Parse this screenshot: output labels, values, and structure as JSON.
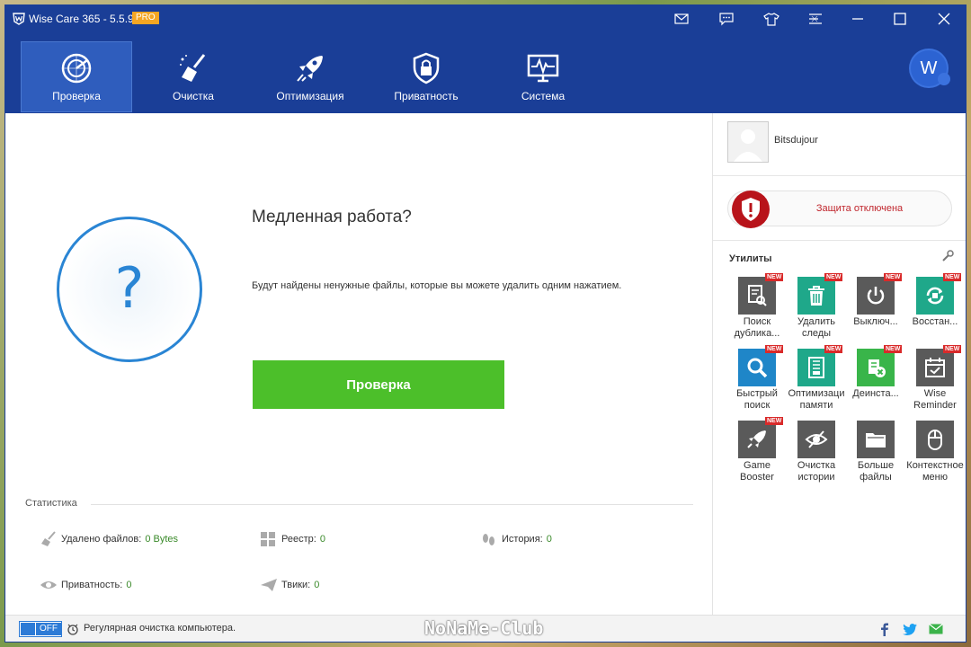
{
  "titlebar": {
    "title": "Wise Care 365 - 5.5.9",
    "badge": "PRO"
  },
  "nav": {
    "tabs": [
      {
        "label": "Проверка",
        "icon": "radar-icon",
        "active": true
      },
      {
        "label": "Очистка",
        "icon": "broom-icon",
        "active": false
      },
      {
        "label": "Оптимизация",
        "icon": "rocket-icon",
        "active": false
      },
      {
        "label": "Приватность",
        "icon": "lock-shield-icon",
        "active": false
      },
      {
        "label": "Система",
        "icon": "monitor-pulse-icon",
        "active": false
      }
    ],
    "account_initial": "W"
  },
  "main": {
    "heading": "Медленная работа?",
    "description": "Будут найдены ненужные файлы, которые вы можете удалить одним нажатием.",
    "scan_button": "Проверка",
    "question_mark": "?"
  },
  "stats": {
    "title": "Статистика",
    "items": [
      {
        "label": "Удалено файлов:",
        "value": "0 Bytes",
        "icon": "broom-icon"
      },
      {
        "label": "Реестр:",
        "value": "0",
        "icon": "registry-blocks-icon"
      },
      {
        "label": "История:",
        "value": "0",
        "icon": "footprints-icon"
      },
      {
        "label": "Приватность:",
        "value": "0",
        "icon": "eye-icon"
      },
      {
        "label": "Твики:",
        "value": "0",
        "icon": "paper-plane-icon"
      }
    ]
  },
  "side": {
    "user_name": "Bitsdujour",
    "protection_status": "Защита отключена",
    "utilities_title": "Утилиты",
    "new_label": "NEW",
    "tools": [
      {
        "line1": "Поиск",
        "line2": "дублика...",
        "color": "#5a5a5a",
        "icon": "duplicate-search-icon",
        "new": true
      },
      {
        "line1": "Удалить",
        "line2": "следы",
        "color": "#1fa88a",
        "icon": "trash-icon",
        "new": true
      },
      {
        "line1": "Выключ...",
        "line2": "",
        "color": "#5a5a5a",
        "icon": "power-icon",
        "new": true
      },
      {
        "line1": "Восстан...",
        "line2": "",
        "color": "#1fa88a",
        "icon": "restore-icon",
        "new": true
      },
      {
        "line1": "Быстрый",
        "line2": "поиск",
        "color": "#1f86c8",
        "icon": "magnifier-icon",
        "new": true
      },
      {
        "line1": "Оптимизаци",
        "line2": "памяти",
        "color": "#1fa88a",
        "icon": "memory-icon",
        "new": true
      },
      {
        "line1": "Деинста...",
        "line2": "",
        "color": "#39b54a",
        "icon": "uninstall-icon",
        "new": true
      },
      {
        "line1": "Wise",
        "line2": "Reminder",
        "color": "#5a5a5a",
        "icon": "calendar-check-icon",
        "new": true
      },
      {
        "line1": "Game",
        "line2": "Booster",
        "color": "#5a5a5a",
        "icon": "game-rocket-icon",
        "new": true
      },
      {
        "line1": "Очистка",
        "line2": "истории",
        "color": "#5a5a5a",
        "icon": "eye-slash-icon",
        "new": false
      },
      {
        "line1": "Больше",
        "line2": "файлы",
        "color": "#5a5a5a",
        "icon": "folder-icon",
        "new": false
      },
      {
        "line1": "Контекстное",
        "line2": "меню",
        "color": "#5a5a5a",
        "icon": "mouse-icon",
        "new": false
      }
    ]
  },
  "footer": {
    "toggle_label": "OFF",
    "text": "Регулярная очистка компьютера.",
    "watermark": "NoNaMe-Club"
  },
  "colors": {
    "brand_blue": "#1a3e97",
    "scan_green": "#4cbf2a",
    "alert_red": "#b8131a"
  }
}
